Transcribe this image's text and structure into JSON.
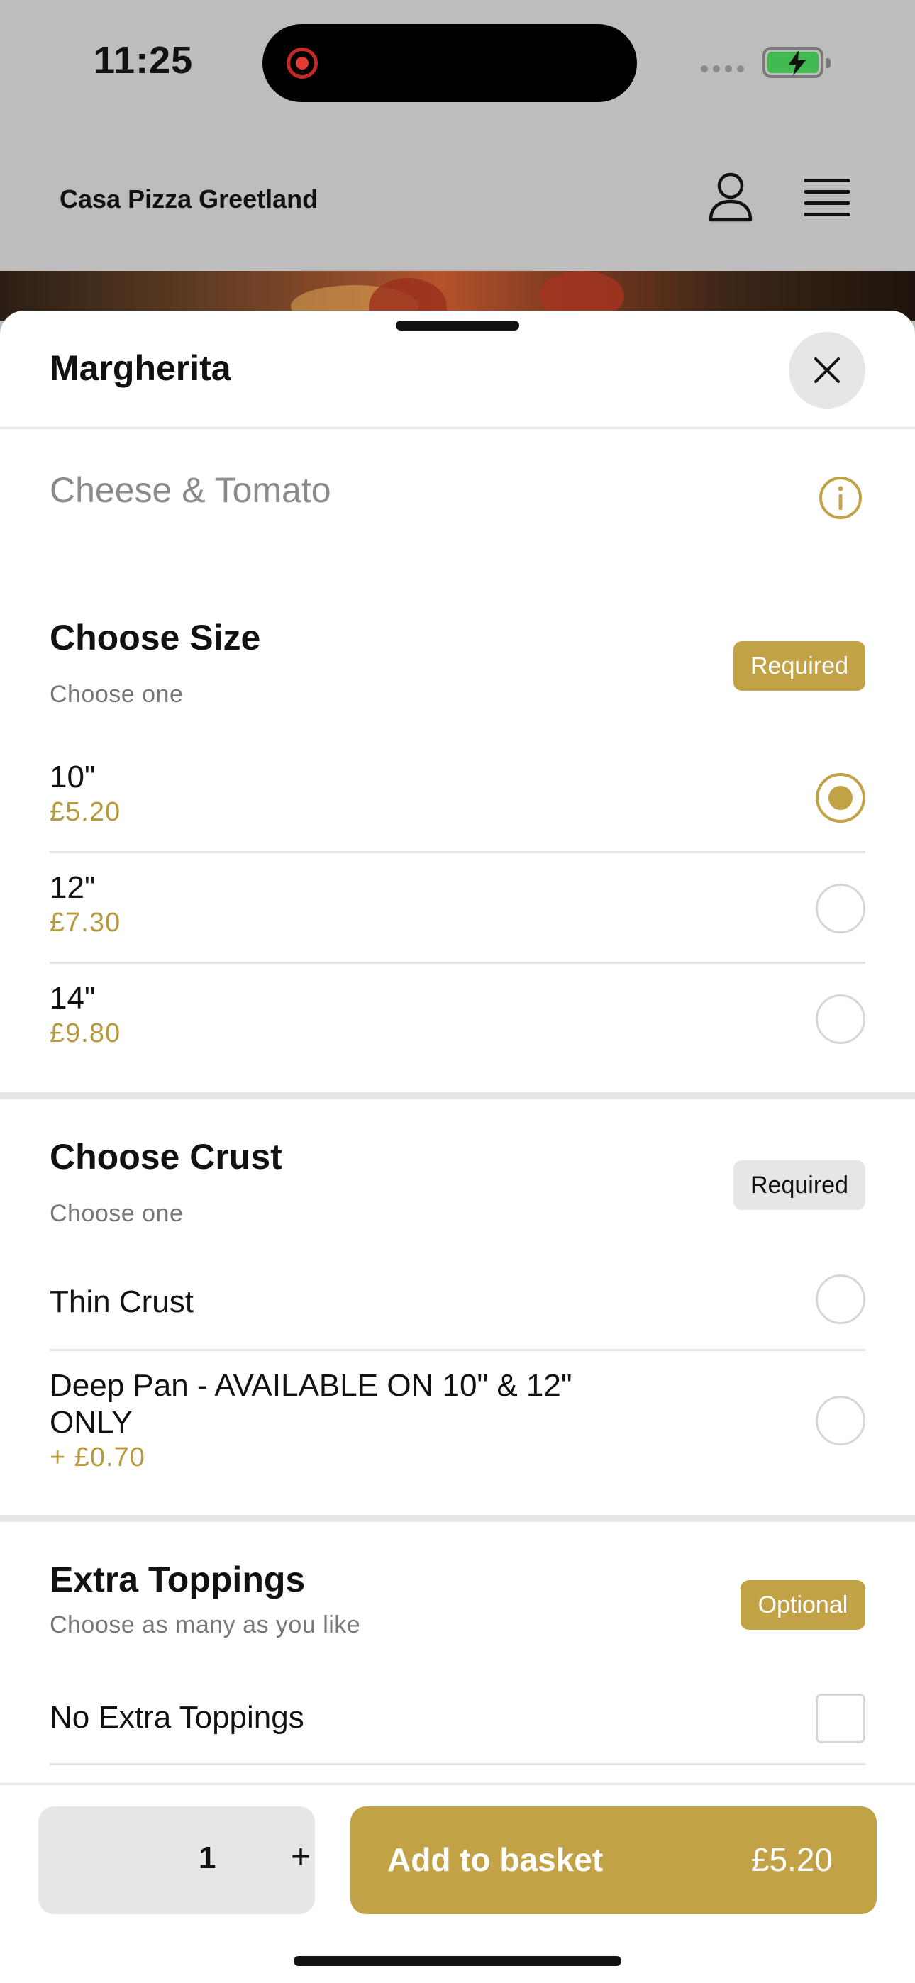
{
  "status_bar": {
    "time": "11:25"
  },
  "header": {
    "restaurant_name": "Casa Pizza Greetland"
  },
  "item": {
    "title": "Margherita",
    "description": "Cheese & Tomato"
  },
  "sections": [
    {
      "title": "Choose Size",
      "subtitle": "Choose one",
      "badge": "Required",
      "options": [
        {
          "label": "10\"",
          "price": "£5.20",
          "selected": true
        },
        {
          "label": "12\"",
          "price": "£7.30",
          "selected": false
        },
        {
          "label": "14\"",
          "price": "£9.80",
          "selected": false
        }
      ]
    },
    {
      "title": "Choose Crust",
      "subtitle": "Choose one",
      "badge": "Required",
      "options": [
        {
          "label": "Thin Crust",
          "price": "",
          "selected": false
        },
        {
          "label": "Deep Pan - AVAILABLE ON 10\" & 12\" ONLY",
          "price": "+ £0.70",
          "selected": false
        }
      ]
    },
    {
      "title": "Extra Toppings",
      "subtitle": "Choose as many as you like",
      "badge": "Optional",
      "options": [
        {
          "label": "No Extra Toppings",
          "checked": false
        }
      ]
    }
  ],
  "footer": {
    "quantity": "1",
    "plus": "+",
    "add_label": "Add to basket",
    "add_price": "£5.20"
  },
  "colors": {
    "accent": "#c2a247",
    "header_bg": "#bdbdbd"
  }
}
